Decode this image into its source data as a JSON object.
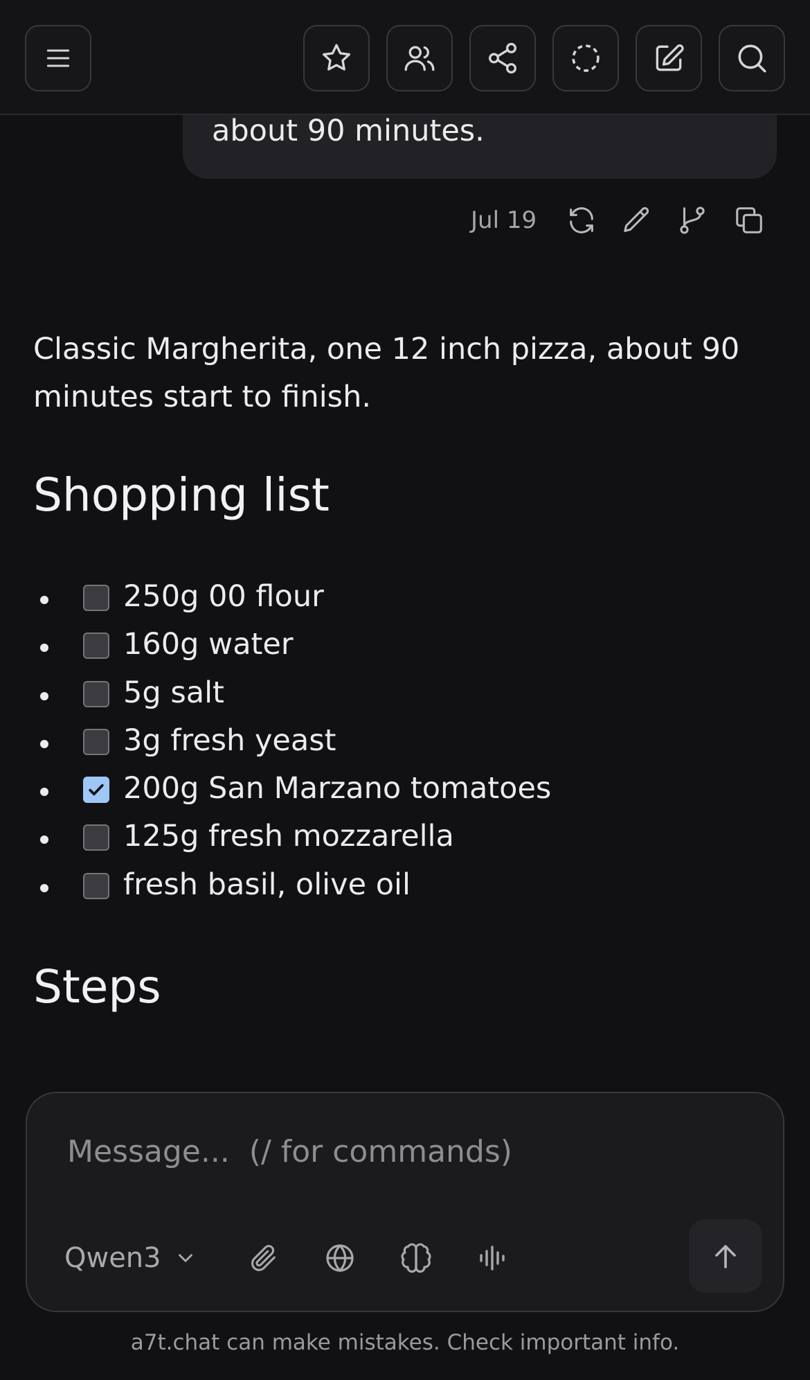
{
  "header": {
    "buttons": [
      {
        "icon": "menu-icon",
        "label": "Menu"
      },
      {
        "icon": "star-icon",
        "label": "Favorite"
      },
      {
        "icon": "users-icon",
        "label": "Participants"
      },
      {
        "icon": "share-icon",
        "label": "Share"
      },
      {
        "icon": "temporary-chat-icon",
        "label": "Temporary chat"
      },
      {
        "icon": "new-chat-icon",
        "label": "New chat"
      },
      {
        "icon": "search-icon",
        "label": "Search"
      }
    ]
  },
  "user_message": {
    "text_tail": "about 90 minutes.",
    "date": "Jul 19",
    "actions": [
      "regenerate-icon",
      "edit-icon",
      "branch-icon",
      "copy-icon"
    ]
  },
  "assistant": {
    "intro": "Classic Margherita, one 12 inch pizza, about 90 minutes start to finish.",
    "shopping_heading": "Shopping list",
    "shopping_items": [
      {
        "text": "250g 00 flour",
        "checked": false
      },
      {
        "text": "160g water",
        "checked": false
      },
      {
        "text": "5g salt",
        "checked": false
      },
      {
        "text": "3g fresh yeast",
        "checked": false
      },
      {
        "text": "200g San Marzano tomatoes",
        "checked": true
      },
      {
        "text": "125g fresh mozzarella",
        "checked": false
      },
      {
        "text": "fresh basil, olive oil",
        "checked": false
      }
    ],
    "steps_heading": "Steps"
  },
  "composer": {
    "placeholder": "Message...  (/ for commands)",
    "value": "",
    "model": "Qwen3",
    "tools": [
      "paperclip-icon",
      "globe-icon",
      "brain-icon",
      "voice-waveform-icon"
    ],
    "send": "arrow-up-icon"
  },
  "footer": {
    "disclaimer": "a7t.chat can make mistakes. Check important info."
  },
  "colors": {
    "background": "#111113",
    "surface": "#1b1b1e",
    "bubble": "#222226",
    "checkbox_checked": "#9fc6f6",
    "text": "#ececee",
    "muted": "#a5a5ab"
  }
}
